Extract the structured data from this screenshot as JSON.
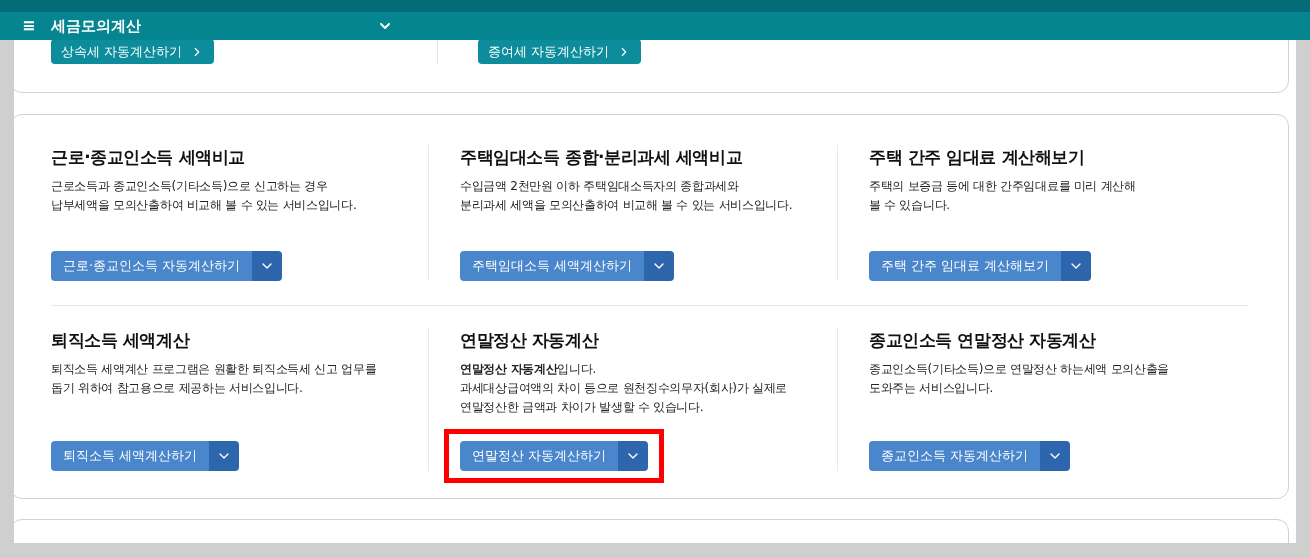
{
  "header": {
    "menu_icon": "≡",
    "title": "세금모의계산"
  },
  "top_links": [
    {
      "label": "상속세 자동계산하기"
    },
    {
      "label": "증여세 자동계산하기"
    }
  ],
  "services": [
    {
      "title": "근로·종교인소득 세액비교",
      "description": [
        "근로소득과 종교인소득(기타소득)으로 신고하는 경우",
        "납부세액을 모의산출하여 비교해 볼 수 있는 서비스입니다."
      ],
      "button": "근로·종교인소득 자동계산하기",
      "highlighted": false
    },
    {
      "title": "주택임대소득 종합·분리과세 세액비교",
      "description": [
        "수입금액 2천만원 이하 주택임대소득자의 종합과세와",
        "분리과세 세액을 모의산출하여 비교해 볼 수 있는 서비스입니다."
      ],
      "button": "주택임대소득 세액계산하기",
      "highlighted": false
    },
    {
      "title": "주택 간주 임대료 계산해보기",
      "description": [
        "주택의 보증금 등에 대한 간주임대료를 미리 계산해",
        "볼 수 있습니다."
      ],
      "button": "주택 간주 임대료 계산해보기",
      "highlighted": false
    },
    {
      "title": "퇴직소득 세액계산",
      "description": [
        "퇴직소득 세액계산 프로그램은 원활한 퇴직소득세 신고 업무를",
        "돕기 위하여 참고용으로 제공하는 서비스입니다."
      ],
      "button": "퇴직소득 세액계산하기",
      "highlighted": false
    },
    {
      "title": "연말정산 자동계산",
      "description": [
        "**연말정산 자동계산**입니다.",
        "과세대상급여액의 차이 등으로 원천징수의무자(회사)가 실제로",
        "연말정산한 금액과 차이가 발생할 수 있습니다."
      ],
      "button": "연말정산 자동계산하기",
      "highlighted": true
    },
    {
      "title": "종교인소득 연말정산 자동계산",
      "description": [
        "종교인소득(기타소득)으로 연말정산 하는세액 모의산출을",
        "도와주는 서비스입니다."
      ],
      "button": "종교인소득 자동계산하기",
      "highlighted": false
    }
  ]
}
